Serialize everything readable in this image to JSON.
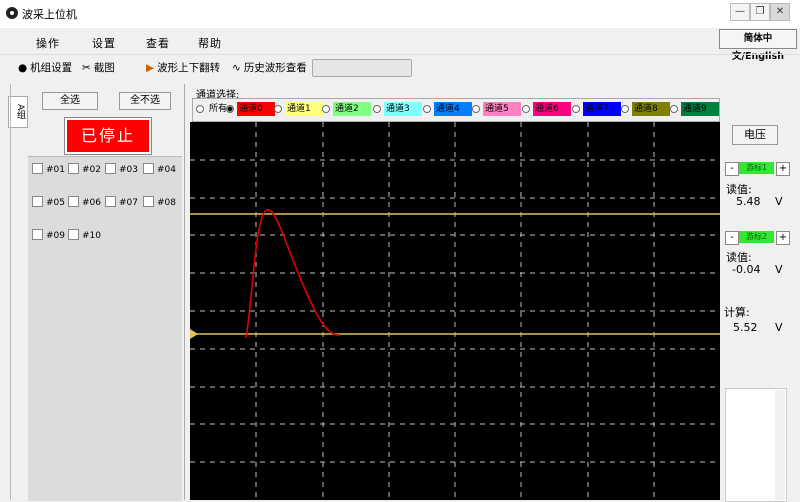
{
  "window": {
    "title": "波采上位机",
    "minimize": "—",
    "restore": "❐",
    "close": "✕"
  },
  "menu": {
    "items": [
      "操作",
      "设置",
      "查看",
      "帮助"
    ],
    "language_button": "简体中文/English"
  },
  "toolbar": {
    "items": [
      {
        "label": "机组设置",
        "icon": "pin-icon",
        "glyph": "📍"
      },
      {
        "label": "截图",
        "icon": "scissors-icon",
        "glyph": "✂"
      },
      {
        "label": "波形上下翻转",
        "icon": "flip-icon",
        "glyph": "↕"
      },
      {
        "label": "历史波形查看",
        "icon": "waveform-icon",
        "glyph": "∿"
      }
    ]
  },
  "left": {
    "side_tab": "A组",
    "select_all": "全选",
    "select_none": "全不选",
    "status": "已停止",
    "status_color": "#ff0000",
    "checkboxes": [
      "#01",
      "#02",
      "#03",
      "#04",
      "#05",
      "#06",
      "#07",
      "#08",
      "#09",
      "#10"
    ]
  },
  "channels": {
    "title": "通道选择:",
    "options": [
      {
        "label": "所有",
        "color": "#f0f0f0",
        "text": "#000",
        "selected": false
      },
      {
        "label": "通道0",
        "color": "#ff0000",
        "text": "#000",
        "selected": true
      },
      {
        "label": "通道1",
        "color": "#ffff80",
        "text": "#000",
        "selected": false
      },
      {
        "label": "通道2",
        "color": "#80ff80",
        "text": "#000",
        "selected": false
      },
      {
        "label": "通道3",
        "color": "#80ffff",
        "text": "#000",
        "selected": false
      },
      {
        "label": "通道4",
        "color": "#0080ff",
        "text": "#000",
        "selected": false
      },
      {
        "label": "通道5",
        "color": "#ff80c0",
        "text": "#000",
        "selected": false
      },
      {
        "label": "通道6",
        "color": "#ff0080",
        "text": "#000",
        "selected": false
      },
      {
        "label": "通道7",
        "color": "#0000ff",
        "text": "#000",
        "selected": false
      },
      {
        "label": "通道8",
        "color": "#808000",
        "text": "#000",
        "selected": false
      },
      {
        "label": "通道9",
        "color": "#008040",
        "text": "#000",
        "selected": false
      }
    ]
  },
  "right": {
    "voltage_button": "电压",
    "cursor1": {
      "label": "游标1",
      "minus": "-",
      "plus": "+",
      "reading_label": "读值:",
      "value": "5.48",
      "unit": "V"
    },
    "cursor2": {
      "label": "游标2",
      "minus": "-",
      "plus": "+",
      "reading_label": "读值:",
      "value": "-0.04",
      "unit": "V"
    },
    "calc": {
      "label": "计算:",
      "value": "5.52",
      "unit": "V"
    }
  },
  "colors": {
    "plot_bg": "#000000",
    "grid": "#c0c0c0",
    "trace": "#e00000",
    "cursor_line": "#e0c060"
  }
}
